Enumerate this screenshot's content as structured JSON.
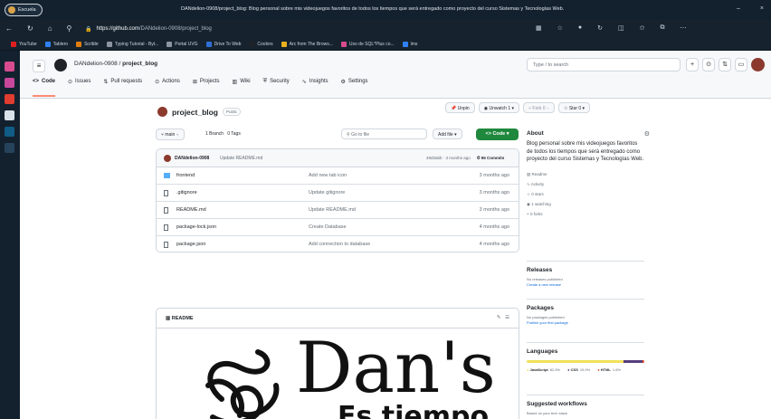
{
  "browser": {
    "profile": "Escuela",
    "window_title": "DANdelion-0908/project_blog: Blog personal sobre mis videojuegos favoritos de todos los tiempos que será entregado como proyecto del curso Sistemas y Tecnologías Web.",
    "url_domain": "https://github.com",
    "url_path": "/DANdelion-0908/project_blog",
    "bookmarks": [
      "YouTube",
      "Tablero",
      "Scribbr",
      "Typing Tutorial - Byt...",
      "Portal UVG",
      "Drive To Web",
      "Coolors",
      "Arc from The Brows...",
      "Uso de SQL*Plus co...",
      "lms"
    ]
  },
  "header": {
    "owner": "DANdelion-0908",
    "separator": "/",
    "repo": "project_blog",
    "search_placeholder": "Type / to search"
  },
  "tabs": [
    "Code",
    "Issues",
    "Pull requests",
    "Actions",
    "Projects",
    "Wiki",
    "Security",
    "Insights",
    "Settings"
  ],
  "repo": {
    "name": "project_blog",
    "visibility": "Public",
    "unpin": "Unpin",
    "unwatch": "Unwatch",
    "watch_count": "1",
    "fork": "Fork",
    "fork_count": "0",
    "star": "Star",
    "star_count": "0"
  },
  "toolbar": {
    "branch": "main",
    "branches": "1 Branch",
    "tags": "0 Tags",
    "go_to_file": "Go to file",
    "shortcut": "t",
    "add_file": "Add file",
    "code": "Code"
  },
  "commit": {
    "author": "DANdelion-0908",
    "message": "Update README.md",
    "info": "49d3abb · 3 months ago",
    "count": "55 Commits"
  },
  "files": [
    {
      "name": "frontend",
      "msg": "Add new tab icon",
      "age": "3 months ago",
      "type": "folder"
    },
    {
      "name": ".gitignore",
      "msg": "Update gitignore",
      "age": "3 months ago",
      "type": "file"
    },
    {
      "name": "README.md",
      "msg": "Update README.md",
      "age": "3 months ago",
      "type": "file"
    },
    {
      "name": "package-lock.json",
      "msg": "Create Database",
      "age": "4 months ago",
      "type": "file"
    },
    {
      "name": "package.json",
      "msg": "Add connection to database",
      "age": "4 months ago",
      "type": "file"
    }
  ],
  "readme": {
    "label": "README",
    "big_title": "Dan's",
    "sub_title": "Es tiempo"
  },
  "about": {
    "title": "About",
    "description": "Blog personal sobre mis videojuegos favoritos de todos los tiempos que será entregado como proyecto del curso Sistemas y Tecnologías Web.",
    "items": [
      "Readme",
      "Activity",
      "0 stars",
      "1 watching",
      "0 forks"
    ]
  },
  "releases": {
    "title": "Releases",
    "none": "No releases published",
    "link": "Create a new release"
  },
  "packages": {
    "title": "Packages",
    "none": "No packages published",
    "link": "Publish your first package"
  },
  "languages": {
    "title": "Languages",
    "list": [
      {
        "name": "JavaScript",
        "pct": "82.5%",
        "value": 82.5,
        "color": "#f1e05a"
      },
      {
        "name": "CSS",
        "pct": "15.9%",
        "value": 15.9,
        "color": "#563d7c"
      },
      {
        "name": "HTML",
        "pct": "1.6%",
        "value": 1.6,
        "color": "#e34c26"
      }
    ]
  },
  "workflows": {
    "title": "Suggested workflows",
    "sub": "Based on your tech stack"
  }
}
